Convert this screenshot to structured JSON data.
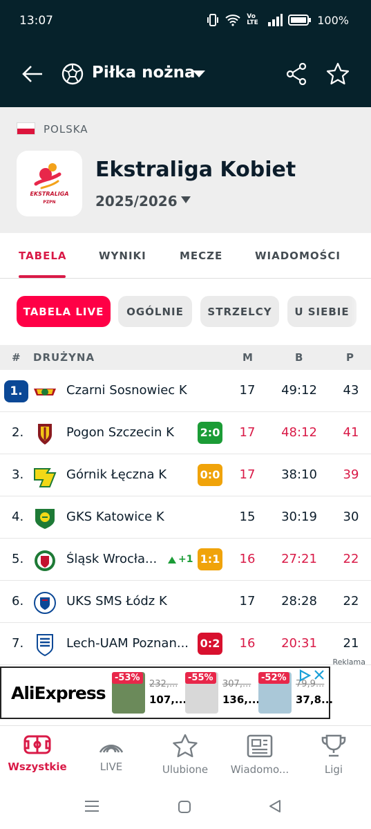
{
  "status": {
    "time": "13:07",
    "network": "Vo LTE",
    "battery": "100%"
  },
  "appbar": {
    "sport": "Piłka nożna"
  },
  "league": {
    "country": "POLSKA",
    "name": "Ekstraliga Kobiet",
    "season": "2025/2026",
    "logo_text": "EKSTRALIGA",
    "logo_sub": "PZPN"
  },
  "tabs": [
    "TABELA",
    "WYNIKI",
    "MECZE",
    "WIADOMOŚCI"
  ],
  "chips": [
    "TABELA LIVE",
    "OGÓLNIE",
    "STRZELCY",
    "U SIEBIE"
  ],
  "table": {
    "headers": {
      "rank": "#",
      "team": "DRUŻYNA",
      "m": "M",
      "b": "B",
      "p": "P"
    },
    "rows": [
      {
        "rank": "1.",
        "team": "Czarni Sosnowiec K",
        "m": "17",
        "b": "49:12",
        "p": "43",
        "live": "",
        "trend": ""
      },
      {
        "rank": "2.",
        "team": "Pogon Szczecin K",
        "m": "17",
        "b": "48:12",
        "p": "41",
        "live": "2:0",
        "trend": ""
      },
      {
        "rank": "3.",
        "team": "Górnik Łęczna K",
        "m": "17",
        "b": "38:10",
        "p": "39",
        "live": "0:0",
        "trend": ""
      },
      {
        "rank": "4.",
        "team": "GKS Katowice K",
        "m": "15",
        "b": "30:19",
        "p": "30",
        "live": "",
        "trend": ""
      },
      {
        "rank": "5.",
        "team": "Śląsk Wrocła...",
        "m": "16",
        "b": "27:21",
        "p": "22",
        "live": "1:1",
        "trend": "+1"
      },
      {
        "rank": "6.",
        "team": "UKS SMS Łódz K",
        "m": "17",
        "b": "28:28",
        "p": "22",
        "live": "",
        "trend": ""
      },
      {
        "rank": "7.",
        "team": "Lech-UAM Poznan...",
        "m": "16",
        "b": "20:31",
        "p": "21",
        "live": "0:2",
        "trend": ""
      }
    ]
  },
  "ad": {
    "label": "Reklama",
    "brand": "AliExpress",
    "products": [
      {
        "discount": "-53%",
        "old": "232,...",
        "new": "107,..."
      },
      {
        "discount": "-55%",
        "old": "307,...",
        "new": "136,..."
      },
      {
        "discount": "-52%",
        "old": "79,9...",
        "new": "37,8..."
      }
    ]
  },
  "bottom_nav": [
    "Wszystkie",
    "LIVE",
    "Ulubione",
    "Wiadomo...",
    "Ligi"
  ],
  "colors": {
    "accent": "#d91a47",
    "dark": "#06222b",
    "leader": "#0b4896",
    "win": "#1b9c36",
    "draw": "#f0a30a",
    "loss": "#d8102e"
  }
}
